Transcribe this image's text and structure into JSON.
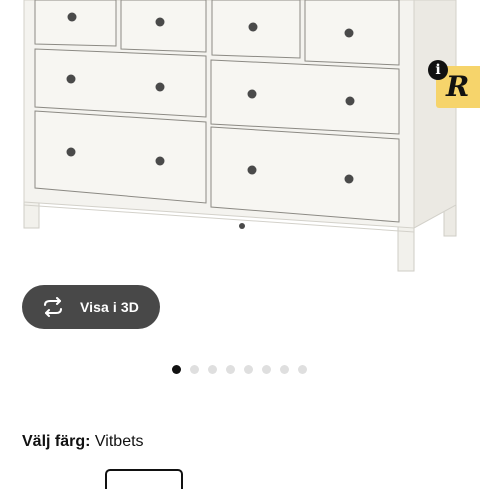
{
  "product": {
    "image_alt": "HEMNES byrå vitbets"
  },
  "badge": {
    "info_glyph": "i",
    "logo_glyph": "R",
    "colors": {
      "tile": "#f6d46b"
    }
  },
  "view3d": {
    "label": "Visa i 3D",
    "icon": "rotate-3d-icon",
    "colors": {
      "bg": "#484848"
    }
  },
  "carousel": {
    "count": 8,
    "active_index": 0
  },
  "color_select": {
    "label": "Välj färg:",
    "value": "Vitbets"
  }
}
